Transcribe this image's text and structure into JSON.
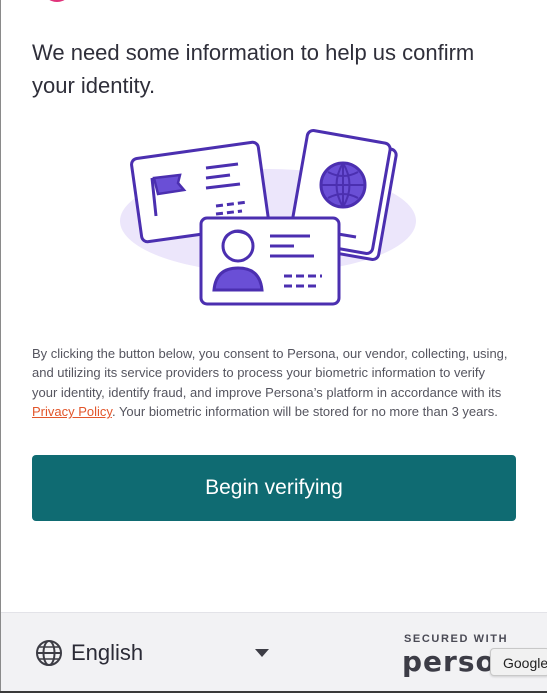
{
  "heading": "We need some information to help us confirm your identity.",
  "consent": {
    "before_link": "By clicking the button below, you consent to Persona, our vendor, collecting, using, and utilizing its service providers to process your biometric information to verify your identity, identify fraud, and improve Persona’s platform in accordance with its ",
    "link_text": "Privacy Policy",
    "after_link": ". Your biometric information will be stored for no more than 3 years."
  },
  "primary_button": {
    "label": "Begin verifying"
  },
  "footer": {
    "language": {
      "selected": "English",
      "icon": "globe-icon"
    },
    "secured_with": "SECURED WITH",
    "brand": "persona"
  },
  "google_badge": "Google",
  "colors": {
    "button": "#0f6b72",
    "link": "#e2562b",
    "illustration_stroke": "#4b2fb0",
    "illustration_fill": "#ece6fb",
    "brand_accent": "#e0337a"
  }
}
